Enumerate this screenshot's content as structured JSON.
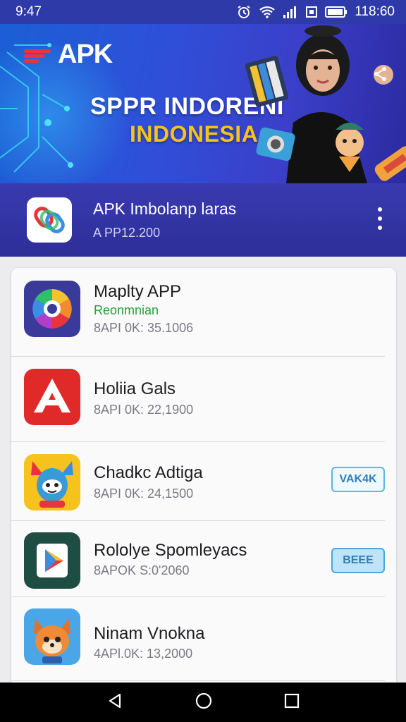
{
  "status": {
    "time": "9:47",
    "clock": "118:60"
  },
  "banner": {
    "logo": "APK",
    "title": "SPPR INDORENI",
    "subtitle": "INDONESIA"
  },
  "featured": {
    "title": "APK Imbolanp laras",
    "subtitle": "A PP12.200"
  },
  "apps": [
    {
      "name": "Maplty  APP",
      "tag": "Reonmnian",
      "meta": "8API 0K: 35.1006"
    },
    {
      "name": "Holiia Gals",
      "meta": "8API 0K: 22,1900"
    },
    {
      "name": "Chadkc Adtiga",
      "meta": "8API 0K: 24,1500",
      "button": "VAK4K"
    },
    {
      "name": "Rololye Spomleyacs",
      "meta": "8APOK S:0'2060",
      "button": "BEEE"
    },
    {
      "name": "Ninam Vnokna",
      "meta": "4APl.0K: 13,2000"
    }
  ],
  "colors": {
    "status_bar": "#2e3aa8",
    "featured_bar": "#2d2e98",
    "accent_yellow": "#f6c21c",
    "green_tag": "#2c9a3b"
  }
}
